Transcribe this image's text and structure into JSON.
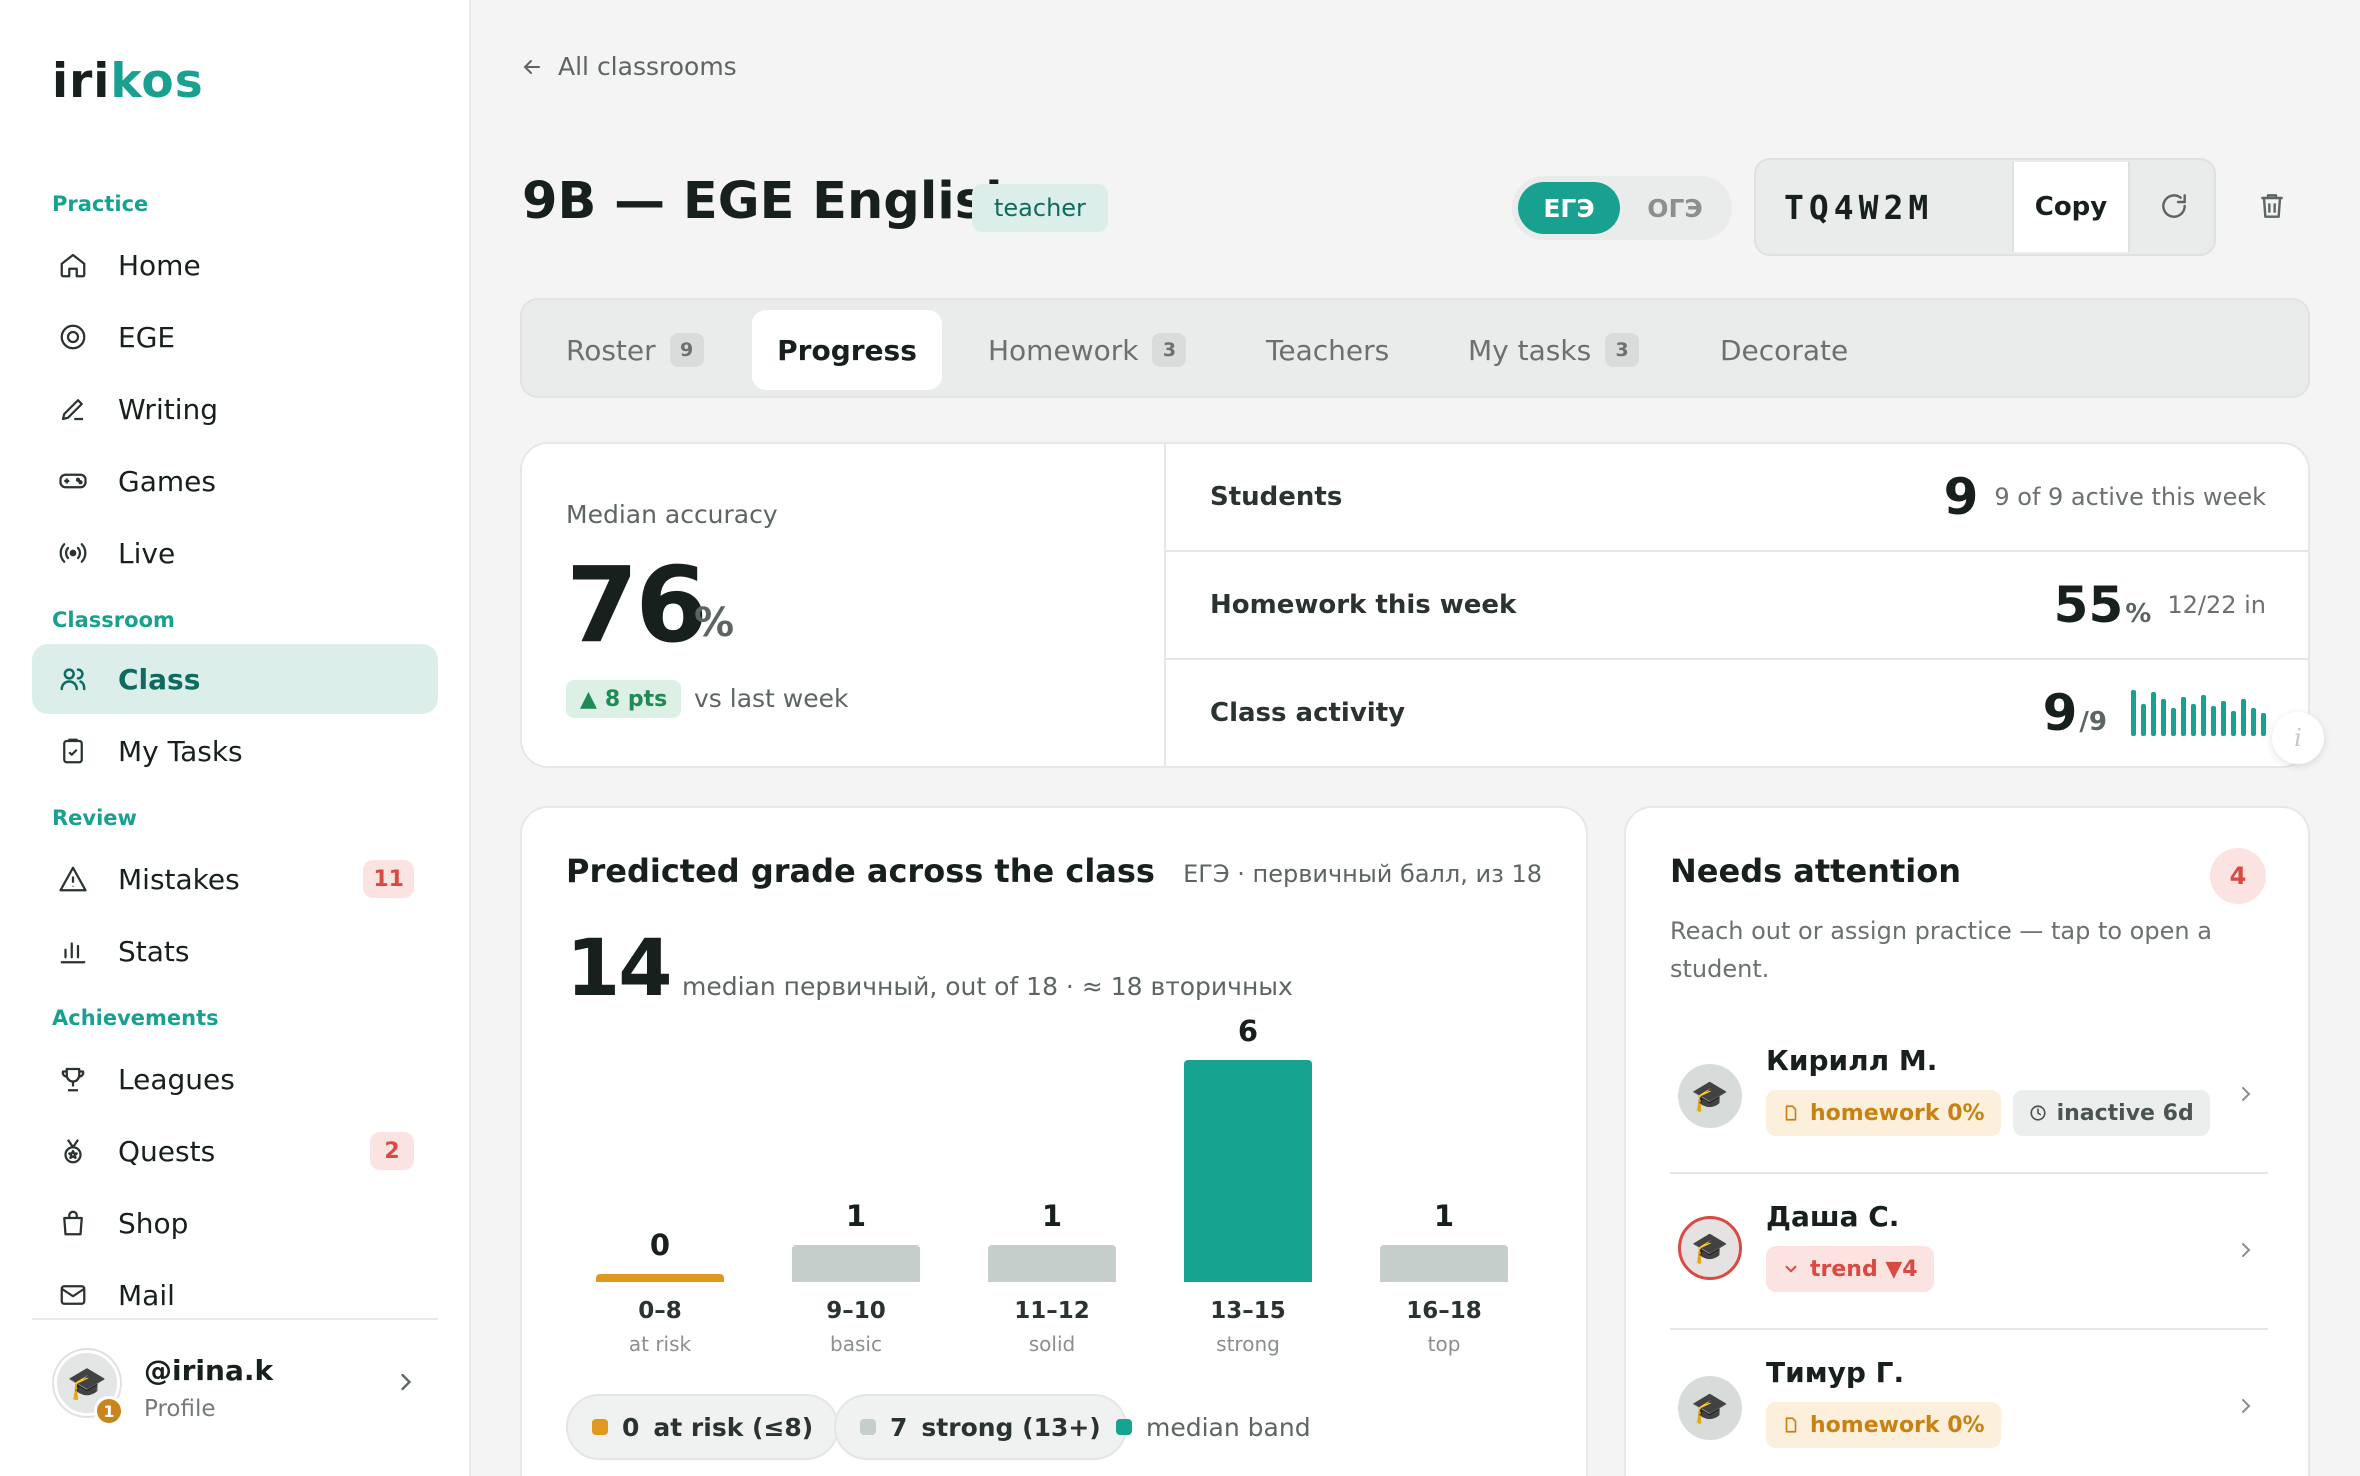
{
  "app": {
    "logo_a": "iri",
    "logo_b": "kos"
  },
  "sidebar": {
    "sections": {
      "practice": "Practice",
      "classroom": "Classroom",
      "review": "Review",
      "achievements": "Achievements"
    },
    "items": {
      "home": {
        "label": "Home",
        "icon": "home-icon"
      },
      "ege": {
        "label": "EGE",
        "icon": "target-icon"
      },
      "writing": {
        "label": "Writing",
        "icon": "pen-icon"
      },
      "games": {
        "label": "Games",
        "icon": "gamepad-icon"
      },
      "live": {
        "label": "Live",
        "icon": "broadcast-icon"
      },
      "class": {
        "label": "Class",
        "icon": "users-icon"
      },
      "my_tasks": {
        "label": "My Tasks",
        "icon": "clipboard-check-icon"
      },
      "mistakes": {
        "label": "Mistakes",
        "icon": "warning-icon",
        "badge": "11"
      },
      "stats": {
        "label": "Stats",
        "icon": "bar-chart-icon"
      },
      "leagues": {
        "label": "Leagues",
        "icon": "trophy-icon"
      },
      "quests": {
        "label": "Quests",
        "icon": "medal-icon",
        "badge": "2"
      },
      "shop": {
        "label": "Shop",
        "icon": "bag-icon"
      },
      "mail": {
        "label": "Mail",
        "icon": "mail-icon"
      }
    },
    "active": "class",
    "profile": {
      "handle": "@irina.k",
      "sub": "Profile",
      "level": "1"
    }
  },
  "header": {
    "back": "All classrooms",
    "title": "9B — EGE English",
    "role": "teacher",
    "exam_options": [
      "ЕГЭ",
      "ОГЭ"
    ],
    "exam_selected": "ЕГЭ",
    "join_code": "TQ4W2M",
    "copy_label": "Copy"
  },
  "tabs": [
    {
      "label": "Roster",
      "badge": "9"
    },
    {
      "label": "Progress",
      "badge": ""
    },
    {
      "label": "Homework",
      "badge": "3"
    },
    {
      "label": "Teachers",
      "badge": ""
    },
    {
      "label": "My tasks",
      "badge": "3"
    },
    {
      "label": "Decorate",
      "badge": ""
    }
  ],
  "active_tab": "Progress",
  "summary": {
    "median_label": "Median accuracy",
    "median_value": "76",
    "median_unit": "%",
    "delta": "8 pts",
    "delta_sub": "vs last week",
    "students_label": "Students",
    "students_value": "9",
    "students_sub": "9 of 9 active this week",
    "homework_label": "Homework this week",
    "homework_value": "55",
    "homework_unit": "%",
    "homework_sub": "12/22 in",
    "activity_label": "Class activity",
    "activity_value": "9",
    "activity_unit": "/9",
    "activity_spark": [
      1.0,
      0.7,
      0.95,
      0.8,
      0.6,
      0.85,
      0.7,
      0.9,
      0.65,
      0.75,
      0.55,
      0.8,
      0.6,
      0.5
    ]
  },
  "grade": {
    "title": "Predicted grade across the class",
    "subtitle": "ЕГЭ · первичный балл, из 18",
    "median": "14",
    "median_sub": "median первичный, out of 18 · ≈ 18 вторичных",
    "legend": {
      "at_risk_count": "0",
      "at_risk_label": "at risk (≤8)",
      "strong_count": "7",
      "strong_label": "strong (13+)",
      "median_band": "median band"
    }
  },
  "chart_data": {
    "type": "bar",
    "categories": [
      "0–8",
      "9–10",
      "11–12",
      "13–15",
      "16–18"
    ],
    "bands": [
      "at risk",
      "basic",
      "solid",
      "strong",
      "top"
    ],
    "values": [
      0,
      1,
      1,
      6,
      1
    ],
    "colors": [
      "#e0981f",
      "#c5cecb",
      "#c5cecb",
      "#16a390",
      "#c5cecb"
    ],
    "ylim": [
      0,
      6
    ]
  },
  "attention": {
    "title": "Needs attention",
    "count": "4",
    "desc": "Reach out or assign practice — tap to open a student.",
    "students": [
      {
        "name": "Кирилл М.",
        "tags": [
          {
            "text": "homework 0%",
            "kind": "warn",
            "icon": "file-icon"
          },
          {
            "text": "inactive 6d",
            "kind": "neutral",
            "icon": "clock-icon"
          }
        ]
      },
      {
        "name": "Даша С.",
        "tags": [
          {
            "text": "trend ▼4",
            "kind": "bad",
            "icon": "chevron-down-icon"
          }
        ]
      },
      {
        "name": "Тимур Г.",
        "tags": [
          {
            "text": "homework 0%",
            "kind": "warn",
            "icon": "file-icon"
          }
        ]
      }
    ]
  }
}
